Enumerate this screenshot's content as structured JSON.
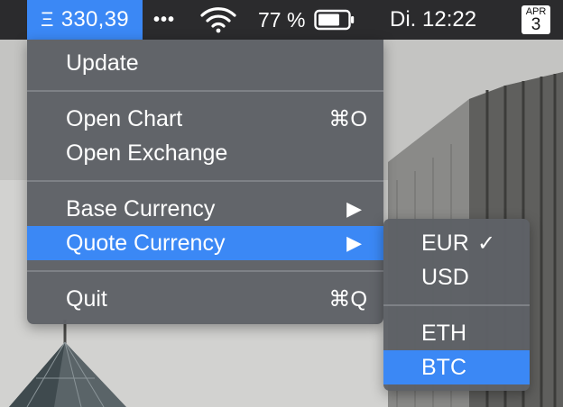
{
  "menubar": {
    "eth_symbol": "Ξ",
    "eth_price": "330,39",
    "more": "•••",
    "battery_percent": "77 %",
    "clock": "Di. 12:22",
    "calendar": {
      "month": "APR",
      "day": "3"
    }
  },
  "main_menu": {
    "items": [
      {
        "label": "Update"
      },
      {
        "label": "Open Chart",
        "shortcut": "⌘O"
      },
      {
        "label": "Open Exchange"
      },
      {
        "label": "Base Currency",
        "arrow": "▶"
      },
      {
        "label": "Quote Currency",
        "arrow": "▶",
        "highlighted": true
      },
      {
        "label": "Quit",
        "shortcut": "⌘Q"
      }
    ]
  },
  "quote_submenu": {
    "items": [
      {
        "label": "EUR",
        "checked": true,
        "check_mark": "✓"
      },
      {
        "label": "USD"
      },
      {
        "label": "ETH"
      },
      {
        "label": "BTC",
        "highlighted": true
      }
    ]
  },
  "colors": {
    "menubar_bg": "#2b2b2d",
    "highlight": "#3b88f5",
    "menu_bg": "#5e6166"
  },
  "icons": [
    "wifi-icon",
    "battery-icon",
    "calendar-icon"
  ]
}
